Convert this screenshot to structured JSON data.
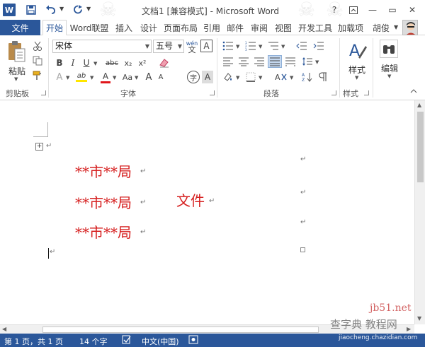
{
  "window": {
    "title": "文档1 [兼容模式] - Microsoft Word",
    "app_logo": "W",
    "controls": {
      "help": "?",
      "ribbon_options": "⊡",
      "minimize": "—",
      "restore": "▭",
      "close": "✕"
    }
  },
  "quick_access": {
    "save_icon": "floppy-icon",
    "undo_icon": "undo-icon",
    "redo_icon": "redo-icon"
  },
  "tabs": {
    "file": "文件",
    "items": [
      "开始",
      "Word联盟",
      "插入",
      "设计",
      "页面布局",
      "引用",
      "邮件",
      "审阅",
      "视图",
      "开发工具",
      "加载项"
    ],
    "active": "开始",
    "user": "胡俊"
  },
  "ribbon": {
    "clipboard": {
      "paste_label": "粘贴",
      "group_label": "剪贴板"
    },
    "font": {
      "font_name": "宋体",
      "font_size": "五号",
      "wen_top": "wén",
      "wen_bottom": "文",
      "boxed_char": "A",
      "bold": "B",
      "italic": "I",
      "underline": "U",
      "strikethrough": "abc",
      "subscript": "x₂",
      "superscript": "x²",
      "text_effect": "A",
      "highlight": "ab",
      "font_color": "A",
      "case": "Aa",
      "grow": "A",
      "shrink": "A",
      "circled_char": "字",
      "phonetic": "A",
      "group_label": "字体"
    },
    "paragraph": {
      "group_label": "段落"
    },
    "styles": {
      "label": "样式",
      "group_label": "样式"
    },
    "editing": {
      "label": "编辑"
    }
  },
  "document": {
    "lines": [
      {
        "text": "**市**局"
      },
      {
        "text": "**市**局",
        "right_text": "文件"
      },
      {
        "text": "**市**局"
      }
    ],
    "colors": {
      "text": "#d62020"
    }
  },
  "status": {
    "page": "第 1 页，共 1 页",
    "words": "14 个字",
    "language": "中文(中国)"
  },
  "watermarks": {
    "site1": "jb51.net",
    "site2": "查字典 教程网",
    "site3": "jiaocheng.chazidian.com"
  },
  "colors": {
    "brand": "#2b579a",
    "doc_text": "#d62020"
  }
}
